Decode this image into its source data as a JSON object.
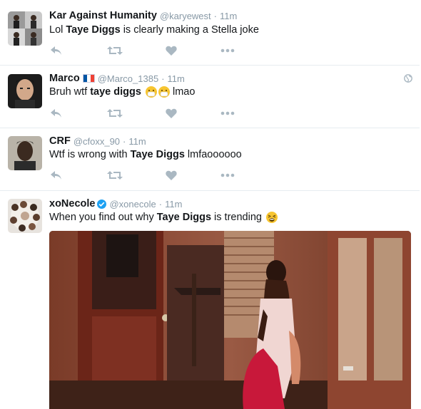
{
  "tweets": [
    {
      "name": "Kar Against Humanity",
      "handle": "@karyewest",
      "sep": "·",
      "time": "11m",
      "text_parts": [
        "Lol ",
        "Taye Diggs",
        " is clearly making a Stella joke"
      ]
    },
    {
      "name": "Marco",
      "handle": "@Marco_1385",
      "sep": "·",
      "time": "11m",
      "text_parts": [
        "Bruh wtf ",
        "taye diggs",
        " lmao"
      ]
    },
    {
      "name": "CRF",
      "handle": "@cfoxx_90",
      "sep": "·",
      "time": "11m",
      "text_parts": [
        "Wtf is wrong with ",
        "Taye Diggs",
        " lmfaoooooo"
      ]
    },
    {
      "name": "xoNecole",
      "handle": "@xonecole",
      "sep": "·",
      "time": "11m",
      "text_parts": [
        "When you find out why ",
        "Taye Diggs",
        " is trending"
      ]
    }
  ],
  "icons": {
    "reply": "reply-icon",
    "retweet": "retweet-icon",
    "like": "heart-icon",
    "more": "more-icon",
    "globe": "globe-icon",
    "verified": "verified-badge-icon"
  },
  "colors": {
    "text": "#14171a",
    "muted": "#8899a6",
    "divider": "#e6ecf0",
    "verified": "#1da1f2"
  }
}
